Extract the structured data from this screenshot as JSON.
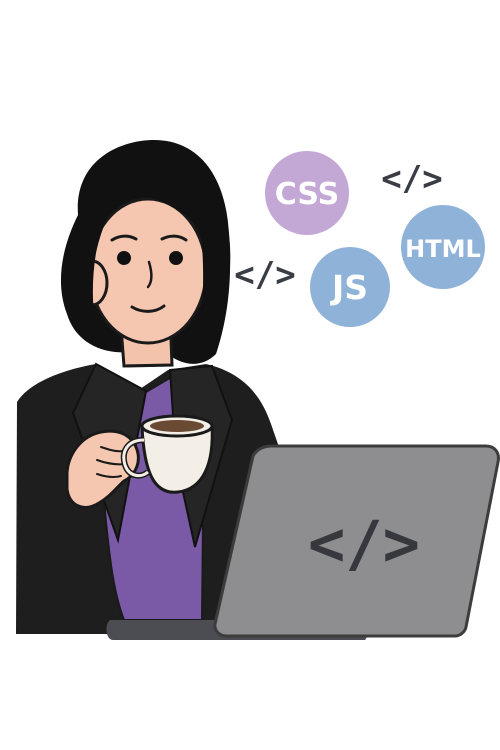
{
  "illustration": {
    "badges": {
      "css": "CSS",
      "js": "JS",
      "html": "HTML"
    },
    "code_tags": {
      "top": "</>",
      "left": "</>",
      "laptop": "</>"
    }
  },
  "colors": {
    "background": "#ffffff",
    "outline": "#1a1a1a",
    "hair": "#111111",
    "skin": "#f6c7b0",
    "cheek": "#f2b39c",
    "jacket": "#1e1e1e",
    "shirt": "#7a5aa6",
    "mug": "#f4efe6",
    "coffee": "#6b4a34",
    "laptop_body": "#8e8e90",
    "laptop_base": "#4b4d52",
    "css_badge": "#c3a8d6",
    "js_badge": "#8fb2d8",
    "html_badge": "#8fb2d8",
    "code_tag": "#3a3d44"
  }
}
